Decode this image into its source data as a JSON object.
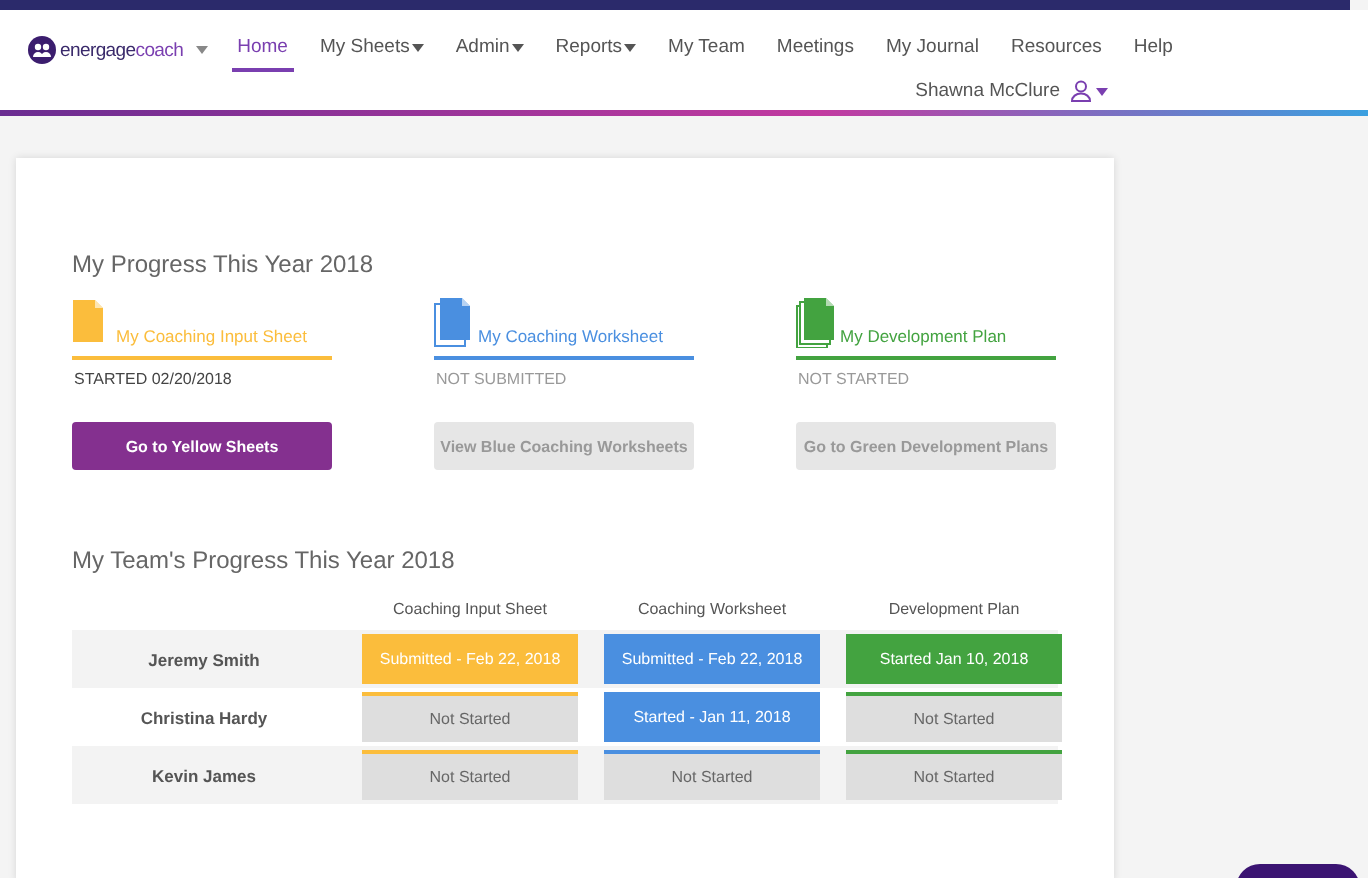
{
  "brand": {
    "prefix": "energage",
    "suffix": "coach"
  },
  "nav": [
    {
      "label": "Home",
      "selected": true,
      "dropdown": false
    },
    {
      "label": "My Sheets",
      "selected": false,
      "dropdown": true
    },
    {
      "label": "Admin",
      "selected": false,
      "dropdown": true
    },
    {
      "label": "Reports",
      "selected": false,
      "dropdown": true
    },
    {
      "label": "My Team",
      "selected": false,
      "dropdown": false
    },
    {
      "label": "Meetings",
      "selected": false,
      "dropdown": false
    },
    {
      "label": "My Journal",
      "selected": false,
      "dropdown": false
    },
    {
      "label": "Resources",
      "selected": false,
      "dropdown": false
    },
    {
      "label": "Help",
      "selected": false,
      "dropdown": false
    }
  ],
  "user": {
    "name": "Shawna McClure"
  },
  "my_progress": {
    "title": "My Progress This Year 2018",
    "sheets": [
      {
        "title": "My Coaching Input Sheet",
        "color": "#fbbd3c",
        "kind": "single",
        "status": "STARTED 02/20/2018",
        "button": "Go to Yellow Sheets",
        "disabled": false
      },
      {
        "title": "My Coaching Worksheet",
        "color": "#4a8fe0",
        "kind": "stack",
        "status": "NOT SUBMITTED",
        "button": "View Blue Coaching Worksheets",
        "disabled": true
      },
      {
        "title": "My Development Plan",
        "color": "#43a340",
        "kind": "stack3",
        "status": "NOT STARTED",
        "button": "Go to Green Development Plans",
        "disabled": true
      }
    ]
  },
  "team_progress": {
    "title": "My Team's Progress This Year 2018",
    "columns": [
      {
        "label": "Coaching Input Sheet",
        "color": "#fbbd3c"
      },
      {
        "label": "Coaching Worksheet",
        "color": "#4a8fe0"
      },
      {
        "label": "Development Plan",
        "color": "#43a340"
      }
    ],
    "rows": [
      {
        "name": "Jeremy Smith",
        "cells": [
          {
            "text": "Submitted - Feb 22, 2018",
            "filled": true
          },
          {
            "text": "Submitted - Feb 22, 2018",
            "filled": true
          },
          {
            "text": "Started Jan 10, 2018",
            "filled": true
          }
        ]
      },
      {
        "name": "Christina Hardy",
        "cells": [
          {
            "text": "Not Started",
            "filled": false
          },
          {
            "text": "Started - Jan 11, 2018",
            "filled": true
          },
          {
            "text": "Not Started",
            "filled": false
          }
        ]
      },
      {
        "name": "Kevin James",
        "cells": [
          {
            "text": "Not Started",
            "filled": false
          },
          {
            "text": "Not Started",
            "filled": false
          },
          {
            "text": "Not Started",
            "filled": false
          }
        ]
      }
    ]
  }
}
